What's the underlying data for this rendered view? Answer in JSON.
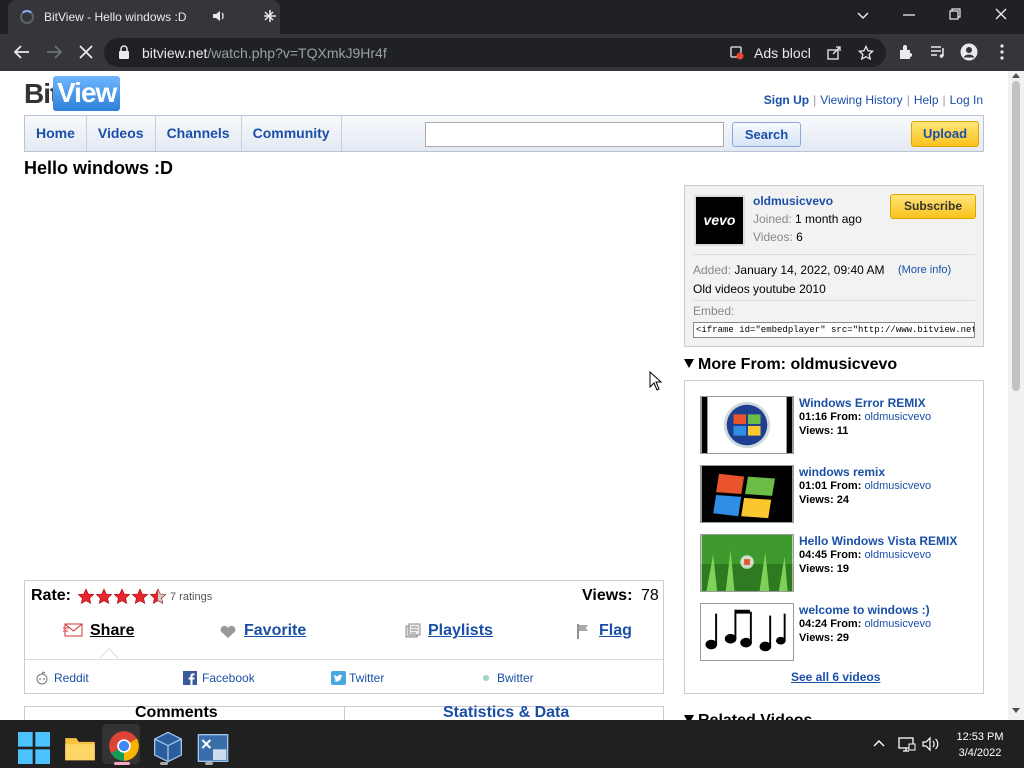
{
  "browser": {
    "tab_title": "BitView - Hello windows :D",
    "url_host": "bitview.net",
    "url_rest": "/watch.php?v=TQXmkJ9Hr4f",
    "extension_label": "Ads blocl"
  },
  "site": {
    "logo_bit": "Bit",
    "logo_view": "View",
    "top_links": [
      "Sign Up",
      "Viewing History",
      "Help",
      "Log In"
    ],
    "nav": [
      "Home",
      "Videos",
      "Channels",
      "Community"
    ],
    "search_placeholder": "",
    "search_button": "Search",
    "upload_button": "Upload"
  },
  "video": {
    "title": "Hello windows :D",
    "rate_label": "Rate:",
    "rating_stars": 4.5,
    "ratings_text": "7 ratings",
    "views_label": "Views:",
    "views_count": "78",
    "actions": [
      "Share",
      "Favorite",
      "Playlists",
      "Flag"
    ],
    "social": [
      "Reddit",
      "Facebook",
      "Twitter",
      "Bwitter"
    ],
    "bottom_tabs": [
      "Comments",
      "Statistics & Data"
    ]
  },
  "channel": {
    "avatar_text": "vevo",
    "name": "oldmusicvevo",
    "joined_label": "Joined:",
    "joined_value": "1 month ago",
    "videos_label": "Videos:",
    "videos_value": "6",
    "subscribe_button": "Subscribe",
    "added_label": "Added:",
    "added_value": "January 14, 2022, 09:40 AM",
    "more_info": "(More info)",
    "description": "Old videos youtube 2010",
    "embed_label": "Embed:",
    "embed_code": "<iframe id=\"embedplayer\" src=\"http://www.bitview.net/embed.p"
  },
  "more_from": {
    "header": "More From: oldmusicvevo",
    "from_label": "From:",
    "views_label": "Views:",
    "videos": [
      {
        "title": "Windows Error REMIX",
        "duration": "01:16",
        "channel": "oldmusicvevo",
        "views": "11"
      },
      {
        "title": "windows remix",
        "duration": "01:01",
        "channel": "oldmusicvevo",
        "views": "24"
      },
      {
        "title": "Hello Windows Vista REMIX",
        "duration": "04:45",
        "channel": "oldmusicvevo",
        "views": "19"
      },
      {
        "title": "welcome to windows :)",
        "duration": "04:24",
        "channel": "oldmusicvevo",
        "views": "29"
      }
    ],
    "see_all": "See all 6 videos"
  },
  "related_header": "Related Videos",
  "taskbar": {
    "time": "12:53 PM",
    "date": "3/4/2022"
  },
  "colors": {
    "link": "#1a4fa8",
    "upload_yellow": "#fbc21b",
    "chrome_dark": "#202124"
  }
}
